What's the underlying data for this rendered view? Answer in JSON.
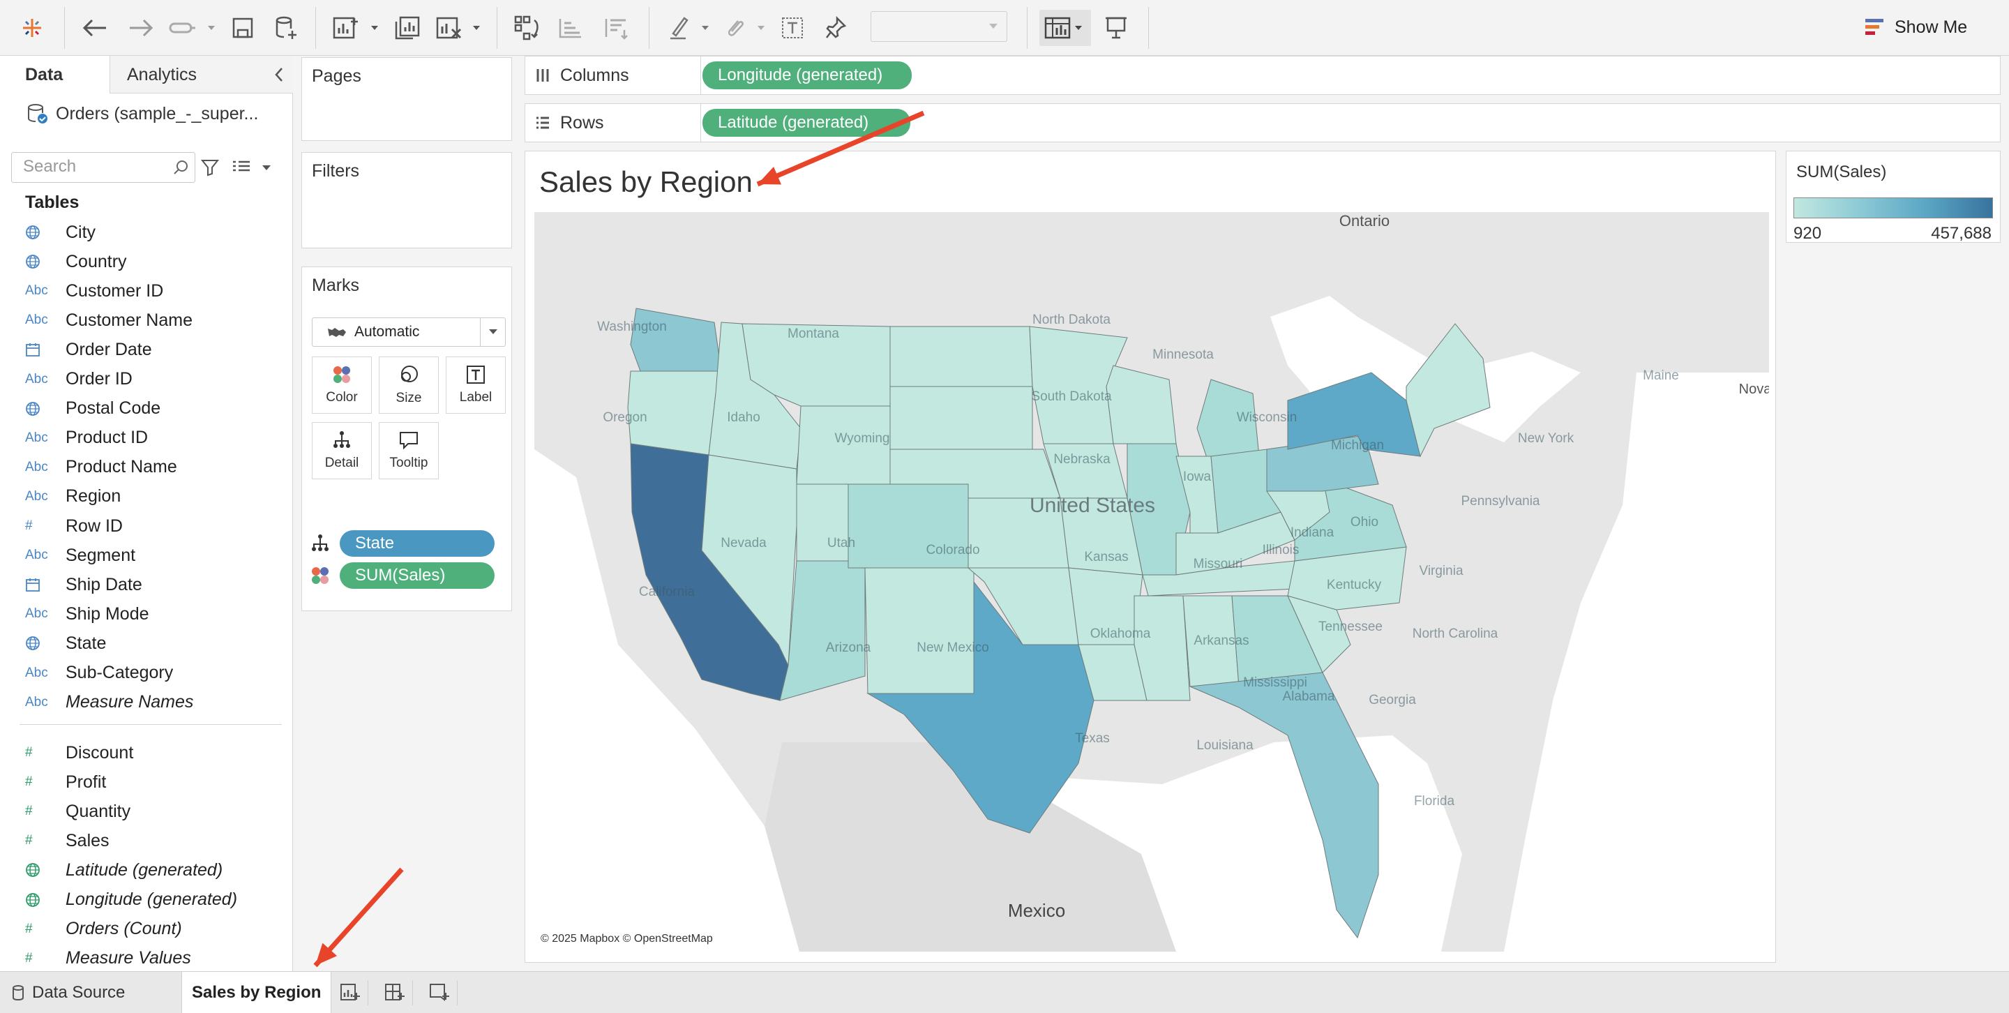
{
  "toolbar": {
    "items": [
      "tableau-logo-icon",
      "undo-icon",
      "redo-icon",
      "redo-all-icon",
      "save-icon",
      "new-datasource-icon",
      "new-sheet-icon",
      "duplicate-sheet-icon",
      "clear-sheet-icon",
      "swap-rows-columns-icon",
      "sort-ascending-icon",
      "sort-descending-icon",
      "highlight-icon",
      "group-icon",
      "show-labels-icon",
      "pin-icon",
      "present-icon"
    ],
    "show_me_label": "Show Me",
    "fit_value": ""
  },
  "data_pane": {
    "tab_data": "Data",
    "tab_analytics": "Analytics",
    "datasource_name": "Orders (sample_-_super...",
    "search_placeholder": "Search",
    "tables_title": "Tables",
    "fields": [
      {
        "label": "City",
        "icon": "globe-icon",
        "type": "geo"
      },
      {
        "label": "Country",
        "icon": "globe-icon",
        "type": "geo"
      },
      {
        "label": "Customer ID",
        "icon": "Abc",
        "type": "string"
      },
      {
        "label": "Customer Name",
        "icon": "Abc",
        "type": "string"
      },
      {
        "label": "Order Date",
        "icon": "calendar-icon",
        "type": "date"
      },
      {
        "label": "Order ID",
        "icon": "Abc",
        "type": "string"
      },
      {
        "label": "Postal Code",
        "icon": "globe-icon",
        "type": "geo"
      },
      {
        "label": "Product ID",
        "icon": "Abc",
        "type": "string"
      },
      {
        "label": "Product Name",
        "icon": "Abc",
        "type": "string"
      },
      {
        "label": "Region",
        "icon": "Abc",
        "type": "string"
      },
      {
        "label": "Row ID",
        "icon": "#",
        "type": "number-dim"
      },
      {
        "label": "Segment",
        "icon": "Abc",
        "type": "string"
      },
      {
        "label": "Ship Date",
        "icon": "calendar-icon",
        "type": "date"
      },
      {
        "label": "Ship Mode",
        "icon": "Abc",
        "type": "string"
      },
      {
        "label": "State",
        "icon": "globe-icon",
        "type": "geo"
      },
      {
        "label": "Sub-Category",
        "icon": "Abc",
        "type": "string"
      },
      {
        "label": "Measure Names",
        "icon": "Abc",
        "type": "string",
        "italic": true
      }
    ],
    "measures": [
      {
        "label": "Discount",
        "icon": "#",
        "italic": false
      },
      {
        "label": "Profit",
        "icon": "#",
        "italic": false
      },
      {
        "label": "Quantity",
        "icon": "#",
        "italic": false
      },
      {
        "label": "Sales",
        "icon": "#",
        "italic": false
      },
      {
        "label": "Latitude (generated)",
        "icon": "globe-icon",
        "italic": true
      },
      {
        "label": "Longitude (generated)",
        "icon": "globe-icon",
        "italic": true
      },
      {
        "label": "Orders (Count)",
        "icon": "#",
        "italic": true
      },
      {
        "label": "Measure Values",
        "icon": "#",
        "italic": true
      }
    ]
  },
  "cards": {
    "pages_title": "Pages",
    "filters_title": "Filters",
    "marks_title": "Marks",
    "mark_type": "Automatic",
    "buttons": {
      "color": "Color",
      "size": "Size",
      "label": "Label",
      "detail": "Detail",
      "tooltip": "Tooltip"
    },
    "mark_pills": {
      "state": "State",
      "sales": "SUM(Sales)"
    }
  },
  "shelves": {
    "columns_label": "Columns",
    "columns_pill": "Longitude (generated)",
    "rows_label": "Rows",
    "rows_pill": "Latitude (generated)"
  },
  "view": {
    "title": "Sales by Region",
    "credit": "© 2025 Mapbox © OpenStreetMap",
    "map_labels": {
      "ontario": "Ontario",
      "nova": "Nova",
      "united_states": "United States",
      "mexico": "Mexico",
      "states": [
        "Washington",
        "Oregon",
        "California",
        "Nevada",
        "Idaho",
        "Montana",
        "Wyoming",
        "Utah",
        "Arizona",
        "Colorado",
        "New Mexico",
        "North Dakota",
        "South Dakota",
        "Nebraska",
        "Kansas",
        "Oklahoma",
        "Texas",
        "Minnesota",
        "Iowa",
        "Missouri",
        "Arkansas",
        "Louisiana",
        "Wisconsin",
        "Illinois",
        "Michigan",
        "Indiana",
        "Ohio",
        "Kentucky",
        "Tennessee",
        "Mississippi",
        "Alabama",
        "Georgia",
        "Florida",
        "North Carolina",
        "Virginia",
        "Pennsylvania",
        "New York",
        "Maine"
      ]
    }
  },
  "legend": {
    "title": "SUM(Sales)",
    "min_label": "920",
    "max_label": "457,688",
    "colors": [
      "#c2e7e0",
      "#38739e"
    ]
  },
  "bottom_bar": {
    "data_source_label": "Data Source",
    "sheet_label": "Sales by Region",
    "icons": [
      "new-worksheet-icon",
      "new-dashboard-icon",
      "new-story-icon"
    ]
  },
  "annotations": {
    "arrow_color": "#e8442a"
  }
}
